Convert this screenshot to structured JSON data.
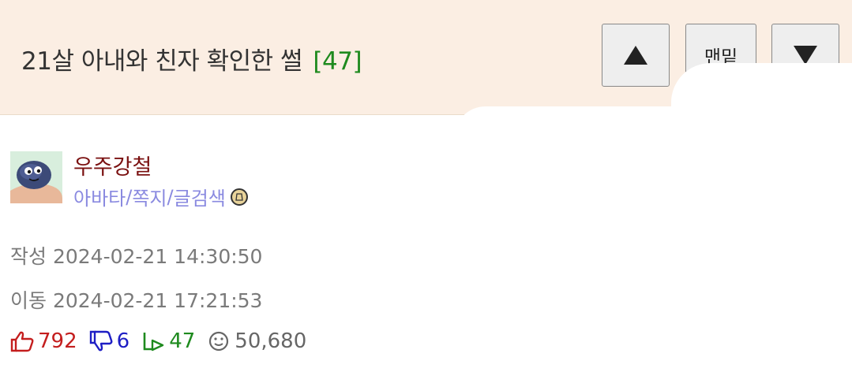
{
  "post": {
    "title": "21살 아내와 친자 확인한 썰",
    "comment_count": "[47]"
  },
  "nav": {
    "up_icon": "triangle-up-icon",
    "bottom_label": "맨밑",
    "down_icon": "triangle-down-icon"
  },
  "author": {
    "name": "우주강철",
    "links": [
      "아바타",
      "쪽지",
      "글검색"
    ],
    "link_separator": "/"
  },
  "meta": {
    "created": "작성 2024-02-21 14:30:50",
    "moved": "이동 2024-02-21 17:21:53"
  },
  "stats": {
    "upvotes": "792",
    "downvotes": "6",
    "replies": "47",
    "views": "50,680"
  },
  "colors": {
    "header_bg": "#fbeee3",
    "author_name": "#7a1010",
    "link": "#8a8ae0",
    "upvote": "#c41e1e",
    "downvote": "#1e1ec4",
    "reply": "#1e8a1e"
  }
}
